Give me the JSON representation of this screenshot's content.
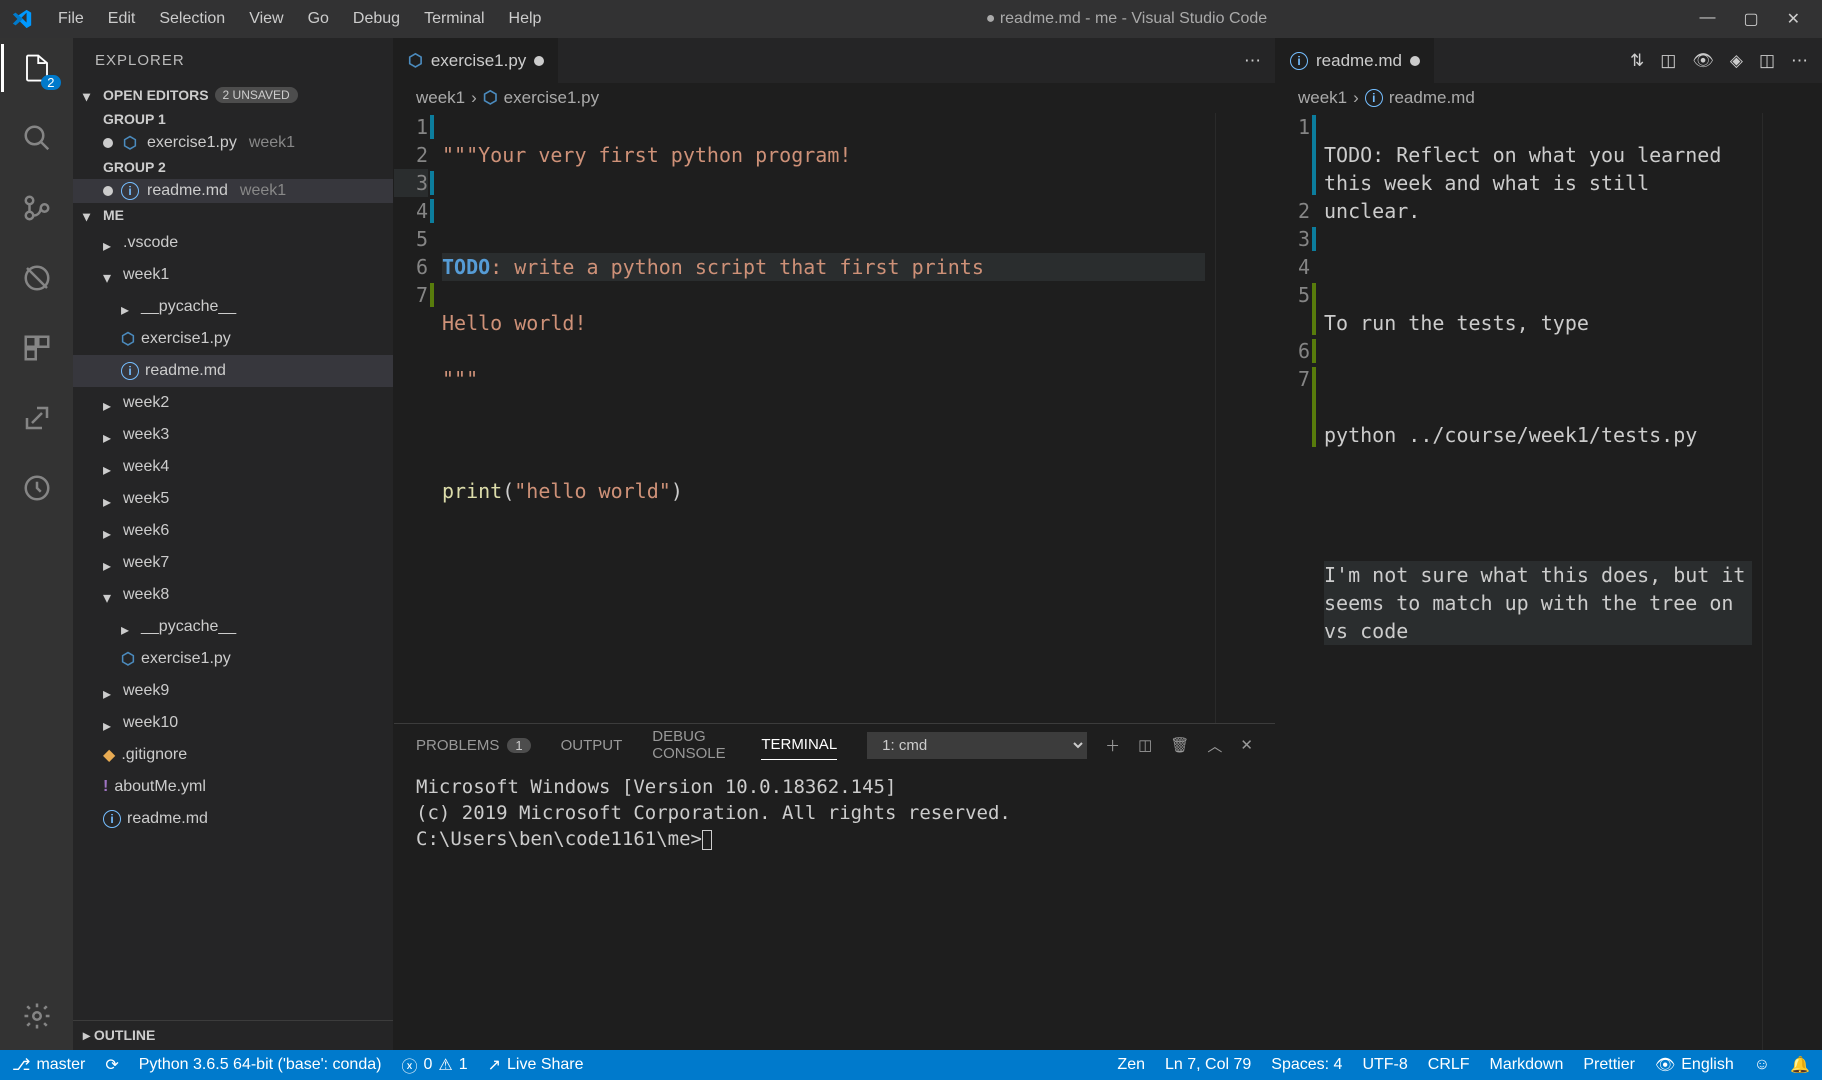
{
  "window": {
    "title": "● readme.md - me - Visual Studio Code"
  },
  "menu": [
    "File",
    "Edit",
    "Selection",
    "View",
    "Go",
    "Debug",
    "Terminal",
    "Help"
  ],
  "activitybar": {
    "explorer_badge": "2"
  },
  "explorer": {
    "title": "EXPLORER",
    "open_editors_label": "OPEN EDITORS",
    "unsaved_badge": "2 UNSAVED",
    "group1_label": "GROUP 1",
    "group2_label": "GROUP 2",
    "open_editors": {
      "g1": {
        "file": "exercise1.py",
        "folder": "week1"
      },
      "g2": {
        "file": "readme.md",
        "folder": "week1"
      }
    },
    "workspace_label": "ME",
    "tree": {
      "vscode": ".vscode",
      "week1": "week1",
      "week1_pycache": "__pycache__",
      "week1_ex1": "exercise1.py",
      "week1_readme": "readme.md",
      "week2": "week2",
      "week3": "week3",
      "week4": "week4",
      "week5": "week5",
      "week6": "week6",
      "week7": "week7",
      "week8": "week8",
      "week8_pycache": "__pycache__",
      "week8_ex1": "exercise1.py",
      "week9": "week9",
      "week10": "week10",
      "gitignore": ".gitignore",
      "aboutme": "aboutMe.yml",
      "root_readme": "readme.md"
    },
    "outline_label": "OUTLINE"
  },
  "editor_left": {
    "tab_label": "exercise1.py",
    "breadcrumb1": "week1",
    "breadcrumb2": "exercise1.py",
    "gutter": [
      "1",
      "2",
      "3",
      "4",
      "5",
      "6",
      "7"
    ],
    "code": {
      "l1a": "\"\"\"",
      "l1b": "Your very first python program!",
      "l2": "",
      "l3a": "TODO",
      "l3b": ": write a python script that first prints",
      "l4": "Hello world!",
      "l5": "\"\"\"",
      "l6": "",
      "l7a": "print",
      "l7b": "(",
      "l7c": "\"hello world\"",
      "l7d": ")"
    }
  },
  "editor_right": {
    "tab_label": "readme.md",
    "breadcrumb1": "week1",
    "breadcrumb2": "readme.md",
    "gutter": [
      "1",
      "2",
      "3",
      "4",
      "5",
      "6",
      "7"
    ],
    "code": {
      "l1": "TODO: Reflect on what you learned this week and what is still unclear.",
      "l2": "",
      "l3": "To run the tests, type",
      "l4": "",
      "l5": "python ../course/week1/tests.py",
      "l6": "",
      "l7": "I'm not sure what this does, but it seems to match up with the tree on vs code"
    }
  },
  "panel": {
    "problems": "PROBLEMS",
    "problems_count": "1",
    "output": "OUTPUT",
    "debug": "DEBUG CONSOLE",
    "terminal": "TERMINAL",
    "shell": "1: cmd",
    "term_l1": "Microsoft Windows [Version 10.0.18362.145]",
    "term_l2": "(c) 2019 Microsoft Corporation. All rights reserved.",
    "term_l3": "C:\\Users\\ben\\code1161\\me>"
  },
  "status": {
    "branch": "master",
    "python": "Python 3.6.5 64-bit ('base': conda)",
    "errors": "0",
    "warnings": "1",
    "liveshare": "Live Share",
    "zen": "Zen",
    "cursor": "Ln 7, Col 79",
    "spaces": "Spaces: 4",
    "encoding": "UTF-8",
    "eol": "CRLF",
    "lang": "Markdown",
    "prettier": "Prettier",
    "spell": "English"
  }
}
